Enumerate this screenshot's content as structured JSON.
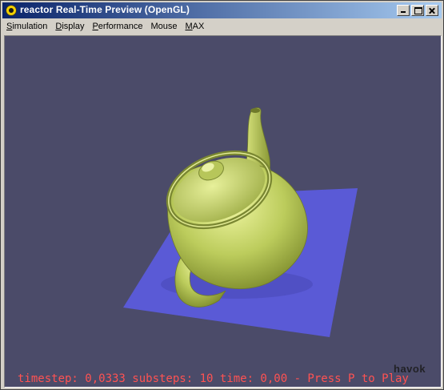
{
  "window": {
    "title": "reactor Real-Time Preview (OpenGL)"
  },
  "menu": {
    "items": [
      {
        "label": "Simulation",
        "underline": "S",
        "rest": "imulation"
      },
      {
        "label": "Display",
        "underline": "D",
        "rest": "isplay"
      },
      {
        "label": "Performance",
        "underline": "P",
        "rest": "erformance"
      },
      {
        "label": "Mouse",
        "underline": "",
        "rest": "Mouse"
      },
      {
        "label": "MAX",
        "underline": "M",
        "rest": "AX"
      }
    ]
  },
  "viewport": {
    "status_text": "timestep: 0,0333 substeps: 10 time: 0,00 - Press P to Play",
    "logo_text": "havok",
    "colors": {
      "background": "#4b4b69",
      "plane": "#5a5ad6",
      "teapot": "#c8d86a",
      "status": "#ff5252"
    }
  }
}
